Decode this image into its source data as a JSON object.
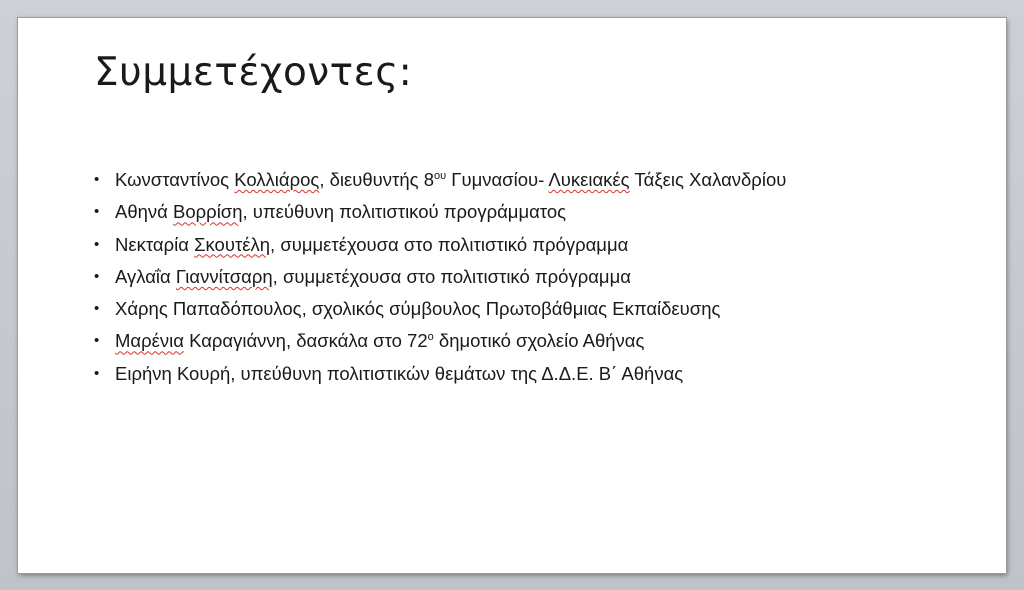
{
  "slide": {
    "title": "Συμμετέχοντες:",
    "bullet_char": "•",
    "items": [
      {
        "segments": [
          {
            "text": "Κωνσταντίνος ",
            "style": "plain"
          },
          {
            "text": "Κολλιάρος",
            "style": "spell"
          },
          {
            "text": ", διευθυντής  8",
            "style": "plain"
          },
          {
            "text": "ου",
            "style": "sup"
          },
          {
            "text": " Γυμνασίου- ",
            "style": "plain"
          },
          {
            "text": "Λυκειακές",
            "style": "spell"
          },
          {
            "text": " Τάξεις Χαλανδρίου",
            "style": "plain"
          }
        ]
      },
      {
        "segments": [
          {
            "text": "Αθηνά ",
            "style": "plain"
          },
          {
            "text": "Βορρίση",
            "style": "spell"
          },
          {
            "text": ", υπεύθυνη πολιτιστικού προγράμματος",
            "style": "plain"
          }
        ]
      },
      {
        "segments": [
          {
            "text": "Νεκταρία ",
            "style": "plain"
          },
          {
            "text": "Σκουτέλη",
            "style": "spell"
          },
          {
            "text": ", συμμετέχουσα στο πολιτιστικό πρόγραμμα",
            "style": "plain"
          }
        ]
      },
      {
        "segments": [
          {
            "text": "Αγλαΐα ",
            "style": "plain"
          },
          {
            "text": "Γιαννίτσαρη",
            "style": "spell"
          },
          {
            "text": ", συμμετέχουσα στο πολιτιστικό πρόγραμμα",
            "style": "plain"
          }
        ]
      },
      {
        "segments": [
          {
            "text": "Χάρης Παπαδόπουλος, σχολικός σύμβουλος Πρωτοβάθμιας Εκπαίδευσης",
            "style": "plain"
          }
        ]
      },
      {
        "segments": [
          {
            "text": "Μαρένια",
            "style": "spell"
          },
          {
            "text": " Καραγιάννη, δασκάλα στο 72",
            "style": "plain"
          },
          {
            "text": "ο",
            "style": "sup"
          },
          {
            "text": " δημοτικό σχολείο Αθήνας",
            "style": "plain"
          }
        ]
      },
      {
        "segments": [
          {
            "text": "Ειρήνη Κουρή, υπεύθυνη πολιτιστικών θεμάτων της Δ.Δ.Ε.  Β΄ Αθήνας",
            "style": "plain"
          }
        ]
      }
    ]
  }
}
